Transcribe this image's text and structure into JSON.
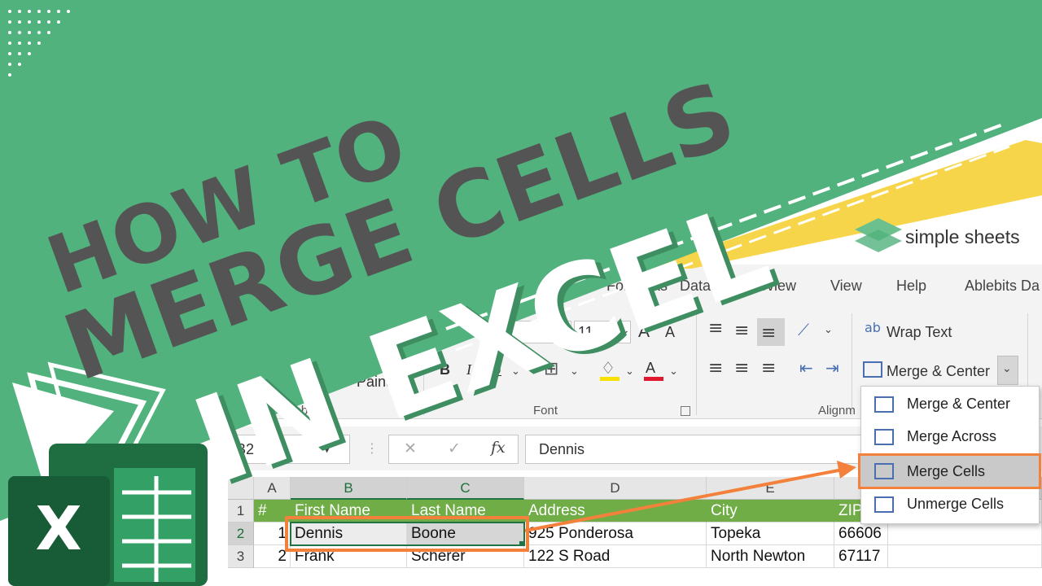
{
  "brand": {
    "name": "simple sheets",
    "colors": {
      "green_bg": "#52b27d",
      "dark_text": "#545454",
      "accent_orange": "#f4813b",
      "accent_yellow": "#f7d54a",
      "excel_green": "#217346"
    }
  },
  "headline": {
    "line1": "HOW TO",
    "line2": "MERGE CELLS",
    "line3": "IN EXCEL"
  },
  "ribbon": {
    "tabs": [
      "Formulas",
      "Data",
      "Review",
      "View",
      "Help",
      "Ablebits Da"
    ],
    "clipboard": {
      "format_painter": "Painter",
      "group_label": "Clipboard"
    },
    "font": {
      "size": "11",
      "grow": "A",
      "shrink": "A",
      "bold": "B",
      "italic": "I",
      "underline": "U",
      "fill_letter": "A",
      "color_letter": "A",
      "group_label": "Font"
    },
    "alignment": {
      "wrap_text": "Wrap Text",
      "merge_center": "Merge & Center",
      "group_label": "Alignm"
    }
  },
  "formula_bar": {
    "name_box": "B2",
    "cancel": "✕",
    "confirm": "✓",
    "fx": "fx",
    "value": "Dennis"
  },
  "sheet": {
    "columns": [
      "A",
      "B",
      "C",
      "D",
      "E"
    ],
    "rows": [
      "1",
      "2",
      "3"
    ],
    "header_row": [
      "#",
      "First Name",
      "Last Name",
      "Address",
      "City",
      "ZIP"
    ],
    "data": [
      [
        "1",
        "Dennis",
        "Boone",
        "925 Ponderosa",
        "Topeka",
        "66606"
      ],
      [
        "2",
        "Frank",
        "Scherer",
        "122 S Road",
        "North Newton",
        "67117"
      ]
    ]
  },
  "merge_menu": {
    "items": [
      {
        "label": "Merge & Center",
        "icon": "merge-center-icon"
      },
      {
        "label": "Merge Across",
        "icon": "merge-across-icon"
      },
      {
        "label": "Merge Cells",
        "icon": "merge-cells-icon",
        "highlighted": true
      },
      {
        "label": "Unmerge Cells",
        "icon": "unmerge-cells-icon"
      }
    ]
  },
  "icons": [
    "excel-logo-icon",
    "play-chevron-icon",
    "simple-sheets-logo-icon",
    "dropdown-arrow-icon"
  ]
}
